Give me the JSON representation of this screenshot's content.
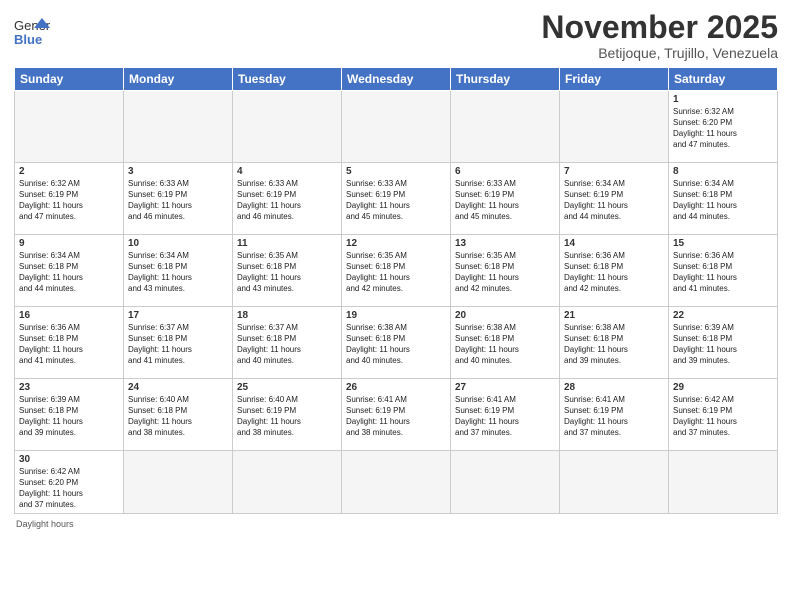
{
  "header": {
    "logo_general": "General",
    "logo_blue": "Blue",
    "month_title": "November 2025",
    "subtitle": "Betijoque, Trujillo, Venezuela"
  },
  "weekdays": [
    "Sunday",
    "Monday",
    "Tuesday",
    "Wednesday",
    "Thursday",
    "Friday",
    "Saturday"
  ],
  "weeks": [
    [
      {
        "day": "",
        "info": ""
      },
      {
        "day": "",
        "info": ""
      },
      {
        "day": "",
        "info": ""
      },
      {
        "day": "",
        "info": ""
      },
      {
        "day": "",
        "info": ""
      },
      {
        "day": "",
        "info": ""
      },
      {
        "day": "1",
        "info": "Sunrise: 6:32 AM\nSunset: 6:20 PM\nDaylight: 11 hours\nand 47 minutes."
      }
    ],
    [
      {
        "day": "2",
        "info": "Sunrise: 6:32 AM\nSunset: 6:19 PM\nDaylight: 11 hours\nand 47 minutes."
      },
      {
        "day": "3",
        "info": "Sunrise: 6:33 AM\nSunset: 6:19 PM\nDaylight: 11 hours\nand 46 minutes."
      },
      {
        "day": "4",
        "info": "Sunrise: 6:33 AM\nSunset: 6:19 PM\nDaylight: 11 hours\nand 46 minutes."
      },
      {
        "day": "5",
        "info": "Sunrise: 6:33 AM\nSunset: 6:19 PM\nDaylight: 11 hours\nand 45 minutes."
      },
      {
        "day": "6",
        "info": "Sunrise: 6:33 AM\nSunset: 6:19 PM\nDaylight: 11 hours\nand 45 minutes."
      },
      {
        "day": "7",
        "info": "Sunrise: 6:34 AM\nSunset: 6:19 PM\nDaylight: 11 hours\nand 44 minutes."
      },
      {
        "day": "8",
        "info": "Sunrise: 6:34 AM\nSunset: 6:18 PM\nDaylight: 11 hours\nand 44 minutes."
      }
    ],
    [
      {
        "day": "9",
        "info": "Sunrise: 6:34 AM\nSunset: 6:18 PM\nDaylight: 11 hours\nand 44 minutes."
      },
      {
        "day": "10",
        "info": "Sunrise: 6:34 AM\nSunset: 6:18 PM\nDaylight: 11 hours\nand 43 minutes."
      },
      {
        "day": "11",
        "info": "Sunrise: 6:35 AM\nSunset: 6:18 PM\nDaylight: 11 hours\nand 43 minutes."
      },
      {
        "day": "12",
        "info": "Sunrise: 6:35 AM\nSunset: 6:18 PM\nDaylight: 11 hours\nand 42 minutes."
      },
      {
        "day": "13",
        "info": "Sunrise: 6:35 AM\nSunset: 6:18 PM\nDaylight: 11 hours\nand 42 minutes."
      },
      {
        "day": "14",
        "info": "Sunrise: 6:36 AM\nSunset: 6:18 PM\nDaylight: 11 hours\nand 42 minutes."
      },
      {
        "day": "15",
        "info": "Sunrise: 6:36 AM\nSunset: 6:18 PM\nDaylight: 11 hours\nand 41 minutes."
      }
    ],
    [
      {
        "day": "16",
        "info": "Sunrise: 6:36 AM\nSunset: 6:18 PM\nDaylight: 11 hours\nand 41 minutes."
      },
      {
        "day": "17",
        "info": "Sunrise: 6:37 AM\nSunset: 6:18 PM\nDaylight: 11 hours\nand 41 minutes."
      },
      {
        "day": "18",
        "info": "Sunrise: 6:37 AM\nSunset: 6:18 PM\nDaylight: 11 hours\nand 40 minutes."
      },
      {
        "day": "19",
        "info": "Sunrise: 6:38 AM\nSunset: 6:18 PM\nDaylight: 11 hours\nand 40 minutes."
      },
      {
        "day": "20",
        "info": "Sunrise: 6:38 AM\nSunset: 6:18 PM\nDaylight: 11 hours\nand 40 minutes."
      },
      {
        "day": "21",
        "info": "Sunrise: 6:38 AM\nSunset: 6:18 PM\nDaylight: 11 hours\nand 39 minutes."
      },
      {
        "day": "22",
        "info": "Sunrise: 6:39 AM\nSunset: 6:18 PM\nDaylight: 11 hours\nand 39 minutes."
      }
    ],
    [
      {
        "day": "23",
        "info": "Sunrise: 6:39 AM\nSunset: 6:18 PM\nDaylight: 11 hours\nand 39 minutes."
      },
      {
        "day": "24",
        "info": "Sunrise: 6:40 AM\nSunset: 6:18 PM\nDaylight: 11 hours\nand 38 minutes."
      },
      {
        "day": "25",
        "info": "Sunrise: 6:40 AM\nSunset: 6:19 PM\nDaylight: 11 hours\nand 38 minutes."
      },
      {
        "day": "26",
        "info": "Sunrise: 6:41 AM\nSunset: 6:19 PM\nDaylight: 11 hours\nand 38 minutes."
      },
      {
        "day": "27",
        "info": "Sunrise: 6:41 AM\nSunset: 6:19 PM\nDaylight: 11 hours\nand 37 minutes."
      },
      {
        "day": "28",
        "info": "Sunrise: 6:41 AM\nSunset: 6:19 PM\nDaylight: 11 hours\nand 37 minutes."
      },
      {
        "day": "29",
        "info": "Sunrise: 6:42 AM\nSunset: 6:19 PM\nDaylight: 11 hours\nand 37 minutes."
      }
    ],
    [
      {
        "day": "30",
        "info": "Sunrise: 6:42 AM\nSunset: 6:20 PM\nDaylight: 11 hours\nand 37 minutes."
      },
      {
        "day": "",
        "info": ""
      },
      {
        "day": "",
        "info": ""
      },
      {
        "day": "",
        "info": ""
      },
      {
        "day": "",
        "info": ""
      },
      {
        "day": "",
        "info": ""
      },
      {
        "day": "",
        "info": ""
      }
    ]
  ],
  "footer": {
    "daylight_label": "Daylight hours"
  }
}
